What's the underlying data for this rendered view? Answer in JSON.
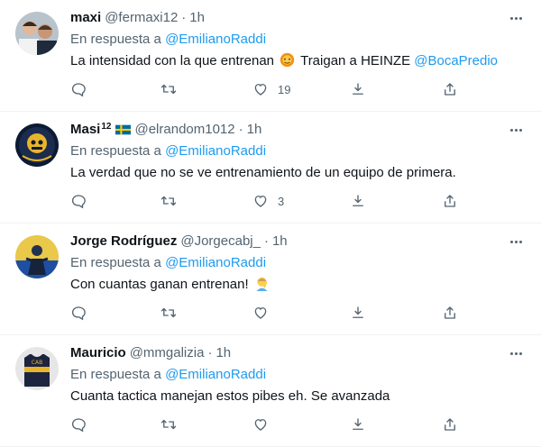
{
  "reply_prefix": "En respuesta a",
  "reply_target": "@EmilianoRaddi",
  "colors": {
    "link": "#1d9bf0",
    "muted": "#536471",
    "text": "#0f1419"
  },
  "tweets": [
    {
      "name": "maxi",
      "name_sup": "",
      "handle": "@fermaxi12",
      "time": "1h",
      "text_before": "La intensidad con la que entrenan",
      "emoji_1": "hot-face-emoji",
      "text_middle": " Traigan a HEINZE ",
      "mention": "@BocaPredio",
      "likes": "19"
    },
    {
      "name": "Masi",
      "name_sup": "12",
      "flag": "sweden-flag",
      "handle": "@elrandom1012",
      "time": "1h",
      "text": "La verdad que no se ve entrenamiento de un equipo de primera.",
      "likes": "3"
    },
    {
      "name": "Jorge Rodríguez",
      "handle": "@Jorgecabj_",
      "time": "1h",
      "text": "Con cuantas ganan entrenan!",
      "emoji": "person-facepalming-emoji",
      "likes": ""
    },
    {
      "name": "Mauricio",
      "handle": "@mmgalizia",
      "time": "1h",
      "text": "Cuanta tactica manejan estos pibes eh. Se avanzada",
      "likes": ""
    }
  ]
}
